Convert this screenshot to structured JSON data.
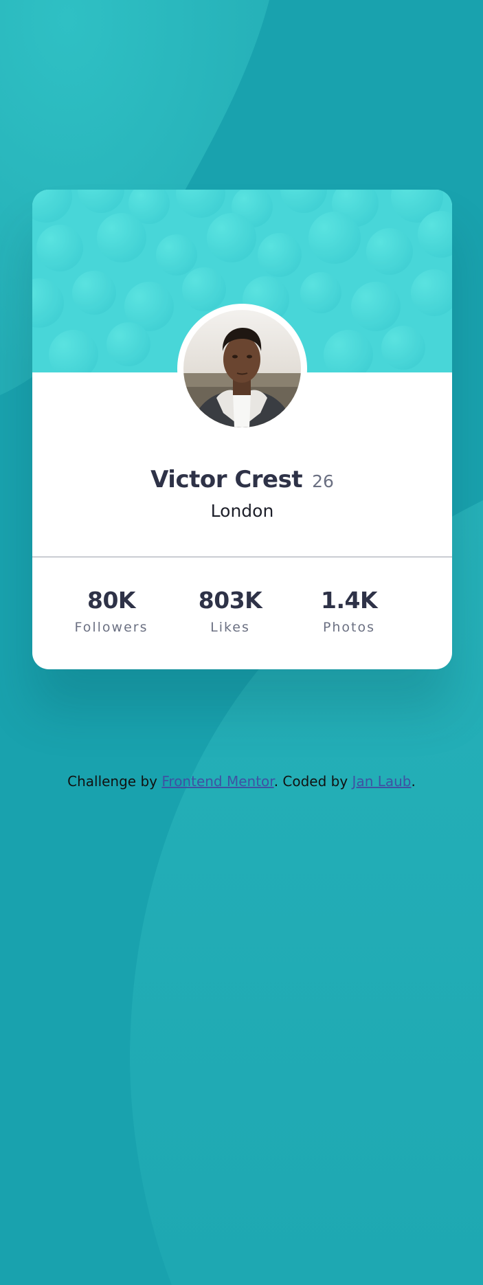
{
  "profile": {
    "name": "Victor Crest",
    "age": "26",
    "city": "London",
    "avatar_alt": "profile-photo"
  },
  "stats": [
    {
      "value": "80K",
      "label": "Followers"
    },
    {
      "value": "803K",
      "label": "Likes"
    },
    {
      "value": "1.4K",
      "label": "Photos"
    }
  ],
  "attribution": {
    "prefix": "Challenge by ",
    "link1": "Frontend Mentor",
    "middle": ". Coded by ",
    "link2": "Jan Laub",
    "suffix": "."
  },
  "colors": {
    "background": "#19a2ae",
    "header": "#48d6d8",
    "text_dark": "#2e3247",
    "text_muted": "#6b7082",
    "link": "#3e52a3"
  }
}
